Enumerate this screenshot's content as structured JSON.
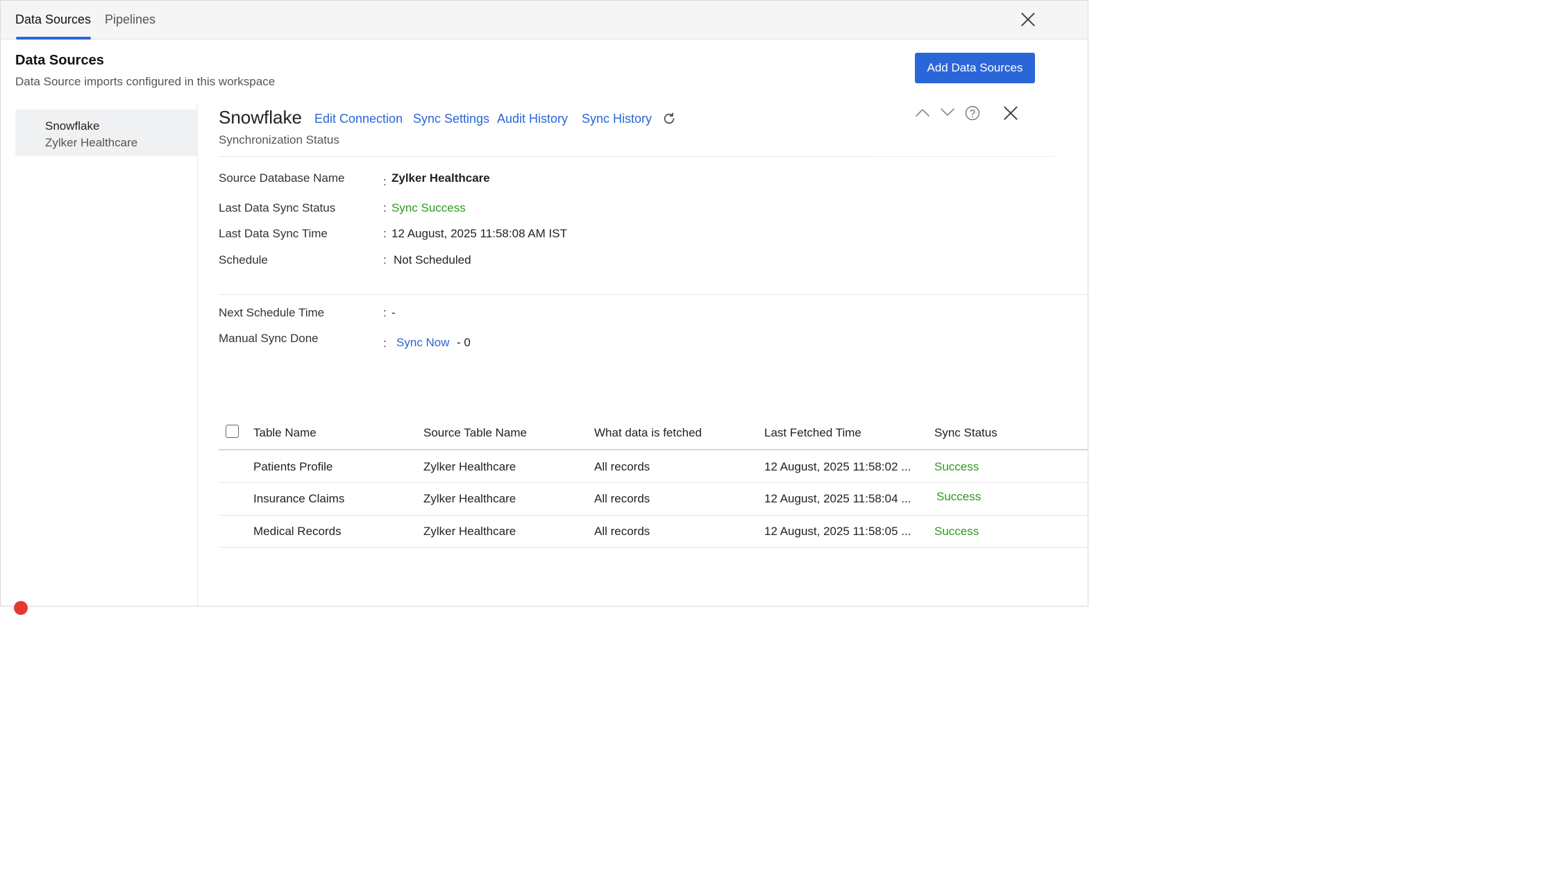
{
  "tabs": [
    {
      "label": "Data Sources",
      "active": true
    },
    {
      "label": "Pipelines",
      "active": false
    }
  ],
  "header": {
    "title": "Data Sources",
    "subtitle": "Data Source imports configured in this workspace",
    "add_button": "Add Data Sources"
  },
  "sidebar": {
    "items": [
      {
        "name": "Snowflake",
        "sub": "Zylker Healthcare",
        "selected": true
      }
    ]
  },
  "detail": {
    "title": "Snowflake",
    "links": {
      "edit_connection": "Edit Connection",
      "sync_settings": "Sync Settings",
      "audit_history": "Audit History",
      "sync_history": "Sync History"
    },
    "section_label": "Synchronization Status",
    "info": {
      "source_db_label": "Source Database Name",
      "source_db_value": "Zylker Healthcare",
      "last_status_label": "Last Data Sync Status",
      "last_status_value": "Sync Success",
      "last_time_label": "Last Data Sync Time",
      "last_time_value": "12 August, 2025 11:58:08 AM IST",
      "schedule_label": "Schedule",
      "schedule_value": "Not Scheduled",
      "next_schedule_label": "Next Schedule Time",
      "next_schedule_value": "-",
      "manual_sync_label": "Manual Sync Done",
      "sync_now": "Sync Now",
      "manual_sync_count": "- 0",
      "colon": ":"
    }
  },
  "table": {
    "columns": [
      "Table Name",
      "Source Table Name",
      "What data is fetched",
      "Last Fetched Time",
      "Sync Status"
    ],
    "rows": [
      {
        "table": "Patients Profile",
        "source": "Zylker Healthcare",
        "fetched": "All records",
        "time": "12 August, 2025 11:58:02 ...",
        "status": "Success"
      },
      {
        "table": "Insurance Claims",
        "source": "Zylker Healthcare",
        "fetched": "All records",
        "time": "12 August, 2025 11:58:04 ...",
        "status": "Success"
      },
      {
        "table": "Medical Records",
        "source": "Zylker Healthcare",
        "fetched": "All records",
        "time": "12 August, 2025 11:58:05 ...",
        "status": "Success"
      }
    ]
  },
  "colors": {
    "accent": "#2a66d8",
    "success": "#2e9a1f"
  },
  "icons": [
    "close-icon",
    "refresh-icon",
    "chevron-up-icon",
    "chevron-down-icon",
    "help-icon",
    "checkbox-icon"
  ]
}
